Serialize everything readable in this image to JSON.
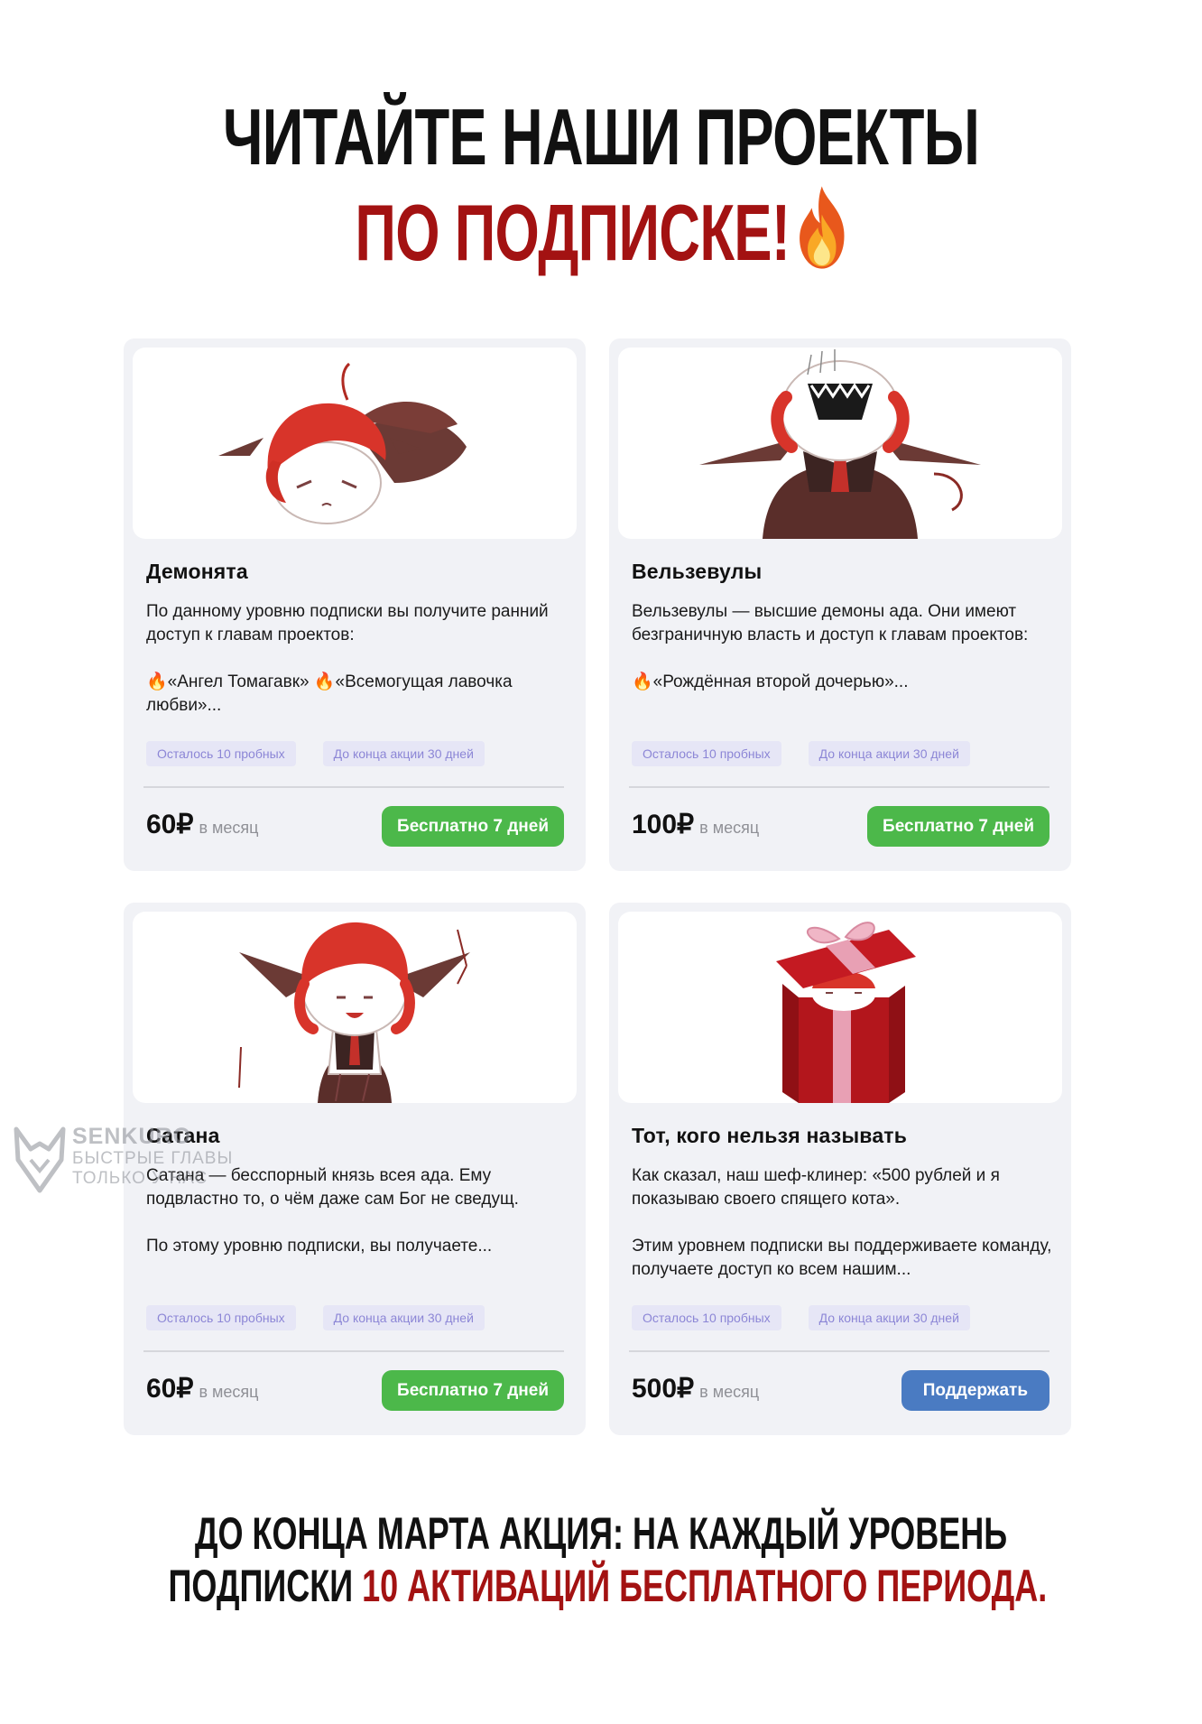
{
  "header": {
    "line1": "ЧИТАЙТЕ НАШИ ПРОЕКТЫ",
    "line2": "ПО ПОДПИСКЕ!",
    "emoji": "fire-icon"
  },
  "cards": [
    {
      "title": "Демонята",
      "desc1": "По данному уровню подписки вы получите ранний доступ к главам проектов:",
      "desc2": "🔥«Ангел Томагавк» 🔥«Всемогущая лавочка любви»...",
      "badge_trials": "Осталось 10 пробных",
      "badge_promo": "До конца акции 30 дней",
      "price": "60₽",
      "period": "в месяц",
      "button": "Бесплатно 7 дней"
    },
    {
      "title": "Вельзевулы",
      "desc1": "Вельзевулы — высшие демоны ада. Они имеют безграничную власть и доступ к главам проектов:",
      "desc2": "🔥«Рождённая второй дочерью»...",
      "badge_trials": "Осталось 10 пробных",
      "badge_promo": "До конца акции 30 дней",
      "price": "100₽",
      "period": "в месяц",
      "button": "Бесплатно 7 дней"
    },
    {
      "title": "Сатана",
      "desc1": "Сатана — бесспорный князь всея ада. Ему подвластно то, о чём даже сам Бог не сведущ.",
      "desc2": "По этому уровню подписки, вы получаете...",
      "badge_trials": "Осталось 10 пробных",
      "badge_promo": "До конца акции 30 дней",
      "price": "60₽",
      "period": "в месяц",
      "button": "Бесплатно 7 дней"
    },
    {
      "title": "Тот, кого нельзя называть",
      "desc1": "Как сказал, наш шеф-клинер: «500 рублей и я показываю своего спящего кота».",
      "desc2": "Этим уровнем подписки вы поддерживаете команду, получаете доступ ко всем нашим...",
      "badge_trials": "Осталось 10 пробных",
      "badge_promo": "До конца акции 30 дней",
      "price": "500₽",
      "period": "в месяц",
      "button": "Поддержать"
    }
  ],
  "watermark": {
    "name": "SENKURO",
    "line1": "БЫСТРЫЕ ГЛАВЫ",
    "line2": "ТОЛЬКО У НАС"
  },
  "footer": {
    "line1": "ДО КОНЦА МАРТА АКЦИЯ: НА КАЖДЫЙ УРОВЕНЬ",
    "line2_black": "ПОДПИСКИ",
    "line2_red": "10 АКТИВАЦИЙ БЕСПЛАТНОГО ПЕРИОДА."
  },
  "colors": {
    "accent_red": "#a31212",
    "button_green": "#4cb84a",
    "button_blue": "#4a7bc2",
    "badge_text": "#8c86d6",
    "card_bg": "#f1f2f6"
  }
}
